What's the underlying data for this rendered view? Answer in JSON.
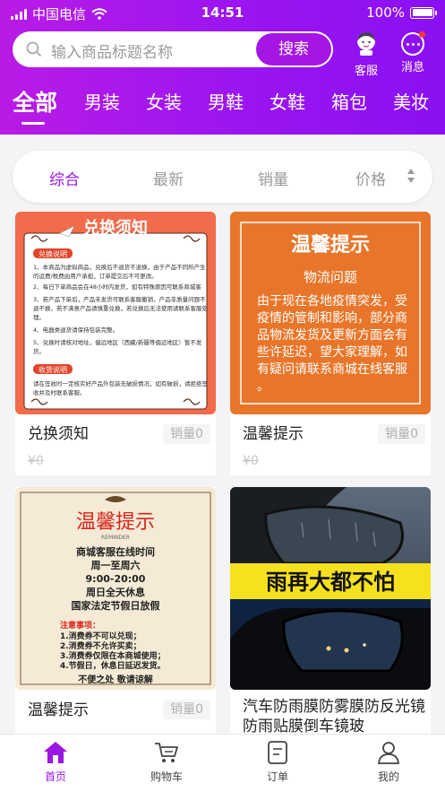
{
  "status_bar": {
    "carrier": "中国电信",
    "time": "14:51",
    "battery": "100%",
    "battery_level": 1.0
  },
  "search": {
    "placeholder": "输入商品标题名称",
    "button": "搜索"
  },
  "header_actions": {
    "service": "客服",
    "messages": "消息"
  },
  "categories": [
    "全部",
    "男装",
    "女装",
    "男鞋",
    "女鞋",
    "箱包",
    "美妆"
  ],
  "active_category": "全部",
  "sort": {
    "items": [
      "综合",
      "最新",
      "销量",
      "价格"
    ],
    "active": "综合"
  },
  "products": [
    {
      "name": "兑换须知",
      "sales": "销量0",
      "price": "¥0",
      "image": {
        "title": "兑换须知",
        "sections": [
          "兑换说明",
          "收货说明"
        ],
        "rules": [
          "1、本商品为虚拟商品，兑换后不退货不退换，由于产品不同所产生的运费/税费由用户承担，订单提交后不可更改。",
          "2、每日下单商品会在48小时内发货，如有特殊原因可联系商城客服。",
          "3、若产品下单后，产品未发货可联系客服撤销，产品非质量问题不退不换，若不满意产品请慎重兑换，若兑换后无法使用请联系客服处理。",
          "4、电器类退货请保持包装完整。",
          "5、兑换时请核对地址，偏远地区（西藏/新疆等偏远地区）暂不发货。"
        ],
        "receipt": "请在签收时一定核实好产品外包装无破损情况，如有破损，请拒绝签收并及时联系客服。"
      }
    },
    {
      "name": "温馨提示",
      "sales": "销量0",
      "price": "¥0",
      "image": {
        "title": "温馨提示",
        "subtitle": "物流问题",
        "text": "由于现在各地疫情突发，受疫情的管制和影响，部分商品物流发货及更新方面会有些许延迟，望大家理解，如有疑问请联系商城在线客服。"
      }
    },
    {
      "name": "温馨提示",
      "sales": "销量0",
      "price": "",
      "image": {
        "title": "温馨提示",
        "reminder": "REMINDER",
        "lines": [
          "商城客服在线时间",
          "周一至周六",
          "9:00-20:00",
          "周日全天休息",
          "国家法定节假日放假"
        ],
        "notes_title": "注意事项：",
        "notes": [
          "1.消费券不可以兑现；",
          "2.消费券不允许买卖；",
          "3.消费券仅限在本商城使用；",
          "4.节假日，休息日延迟发货。"
        ],
        "footer": "不便之处 敬请谅解"
      }
    },
    {
      "name": "汽车防雨膜防雾膜防反光镜防雨贴膜倒车镜玻",
      "sales": "",
      "price": "",
      "image": {
        "banner": "雨再大都不怕"
      }
    }
  ],
  "tabbar": [
    {
      "label": "首页",
      "icon": "home-icon",
      "active": true
    },
    {
      "label": "购物车",
      "icon": "cart-icon",
      "active": false
    },
    {
      "label": "订单",
      "icon": "order-icon",
      "active": false
    },
    {
      "label": "我的",
      "icon": "profile-icon",
      "active": false
    }
  ],
  "colors": {
    "brand_purple": "#a516e5",
    "accent_orange": "#e8762a",
    "banner_yellow": "#f6e11f"
  }
}
